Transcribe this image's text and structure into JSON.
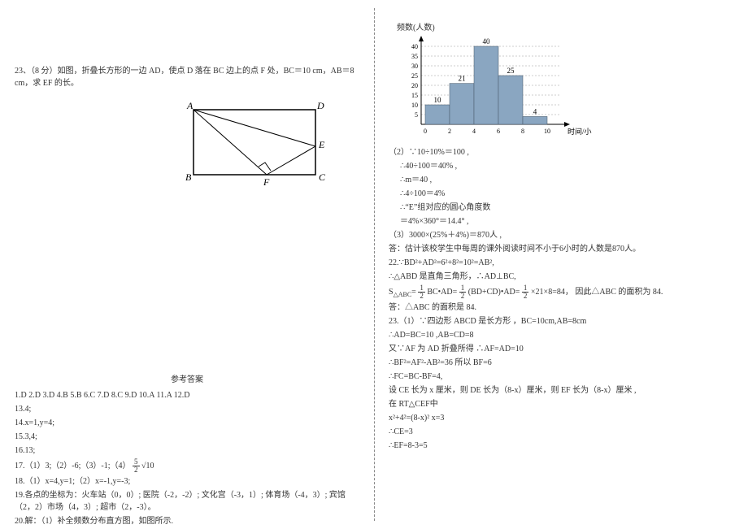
{
  "left": {
    "q23": "23、（8 分）如图，折叠长方形的一边 AD，使点 D 落在 BC 边上的点 F 处，BC＝10 cm，AB＝8 cm，求 EF 的长。",
    "fig_labels": {
      "A": "A",
      "B": "B",
      "C": "C",
      "D": "D",
      "E": "E",
      "F": "F"
    },
    "answers_title": "参考答案",
    "mc": "1.D   2.D   3.D   4.B   5.B   6.C   7.D   8.C   9.D   10.A   11.A   12.D",
    "a13": "13.4;",
    "a14": "14.x=1,y=4;",
    "a15": "15.3,4;",
    "a16": "16.13;",
    "a17_pre": "17.（1）3;（2）-6;（3）-1;（4）",
    "a17_frac_n": "5",
    "a17_frac_d": "2",
    "a17_sqrt": "√10",
    "a18": "18.（1）x=4,y=1;（2）x=-1,y=-3;",
    "a19": "19.各点的坐标为：火车站（0，0）; 医院（-2，-2）; 文化宫（-3，1）; 体育场（-4，3）; 宾馆（2，2）市场（4，3）; 超市（2，-3）。",
    "a20": "20.解：（1）补全频数分布直方图，如图所示."
  },
  "right": {
    "chart_ylabel": "频数(人数)",
    "chart_xlabel": "时间/小时",
    "r2a": "（2）∵10÷10%＝100 ,",
    "r2b": "∴40÷100＝40% ,",
    "r2c": "∴m＝40 ,",
    "r2d": "∴4÷100＝4%",
    "r2e": "∴“E”组对应的圆心角度数",
    "r2f": "＝4%×360°＝14.4° ,",
    "r3": "（3）3000×(25%＋4%)＝870人 ,",
    "r_ans": "答：估计该校学生中每周的课外阅读时间不小于6小时的人数是870人。",
    "r22a": "22.∵BD²+AD²=6²+8²=10²=AB²,",
    "r22b": "∴△ABD 是直角三角形，∴AD⊥BC,",
    "r22c_pre": "S",
    "r22c_sub": "△ABC",
    "r22c_mid1": "=",
    "r22c_mid2": "BC•AD=",
    "r22c_mid3": "(BD+CD)•AD=",
    "r22c_end": "×21×8=84，  因此△ABC 的面积为 84.",
    "r22d": "答：△ABC 的面积是 84.",
    "r23a": "23.（1）∵四边形 ABCD 是长方形 ，BC=10cm,AB=8cm",
    "r23b": "∴AD=BC=10 ,AB=CD=8",
    "r23c": "又∵AF 为 AD 折叠所得   ∴AF=AD=10",
    "r23d": "∴BF²=AF²-AB²=36    所以 BF=6",
    "r23e": "∴FC=BC-BF=4,",
    "r23f": "设 CE 长为 x 厘米，则 DE 长为（8-x）厘米，则 EF 长为（8-x）厘米 ,",
    "r23g": "在 RT△CEF中",
    "r23h": "x²+4²=(8-x)²  x=3",
    "r23i": "∴CE=3",
    "r23j": "∴EF=8-3=5",
    "half": "1",
    "two": "2"
  },
  "chart_data": {
    "type": "bar",
    "title": "频数(人数)",
    "xlabel": "时间/小时",
    "ylabel": "频数(人数)",
    "categories": [
      "0-2",
      "2-4",
      "4-6",
      "6-8",
      "8-10"
    ],
    "x_ticks": [
      0,
      2,
      4,
      6,
      8,
      10
    ],
    "values": [
      10,
      21,
      40,
      25,
      4
    ],
    "ylim": [
      0,
      40
    ],
    "y_ticks": [
      5,
      10,
      15,
      20,
      25,
      30,
      35,
      40
    ]
  }
}
